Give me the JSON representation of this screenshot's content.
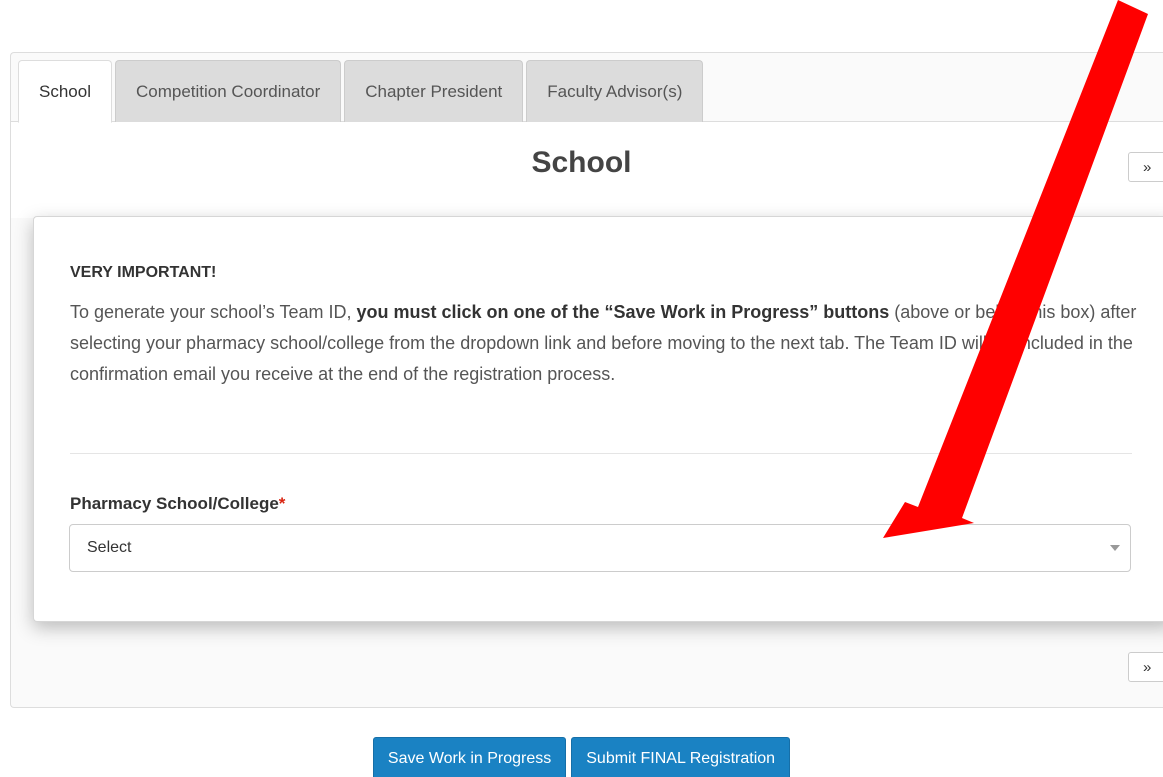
{
  "tabs": [
    {
      "label": "School",
      "active": true
    },
    {
      "label": "Competition Coordinator",
      "active": false
    },
    {
      "label": "Chapter President",
      "active": false
    },
    {
      "label": "Faculty Advisor(s)",
      "active": false
    }
  ],
  "section": {
    "title": "School",
    "next_label": "»"
  },
  "notice": {
    "heading": "VERY IMPORTANT!",
    "text_before": "To generate your school’s Team ID, ",
    "text_bold": "you must click on one of the “Save Work in Progress” buttons",
    "text_after": " (above or below this box) after selecting your pharmacy school/college from the dropdown link and before moving to the next tab. The Team ID will be included in the confirmation email you receive at the end of the registration process."
  },
  "field": {
    "label": "Pharmacy School/College",
    "required_mark": "*",
    "value": "Select"
  },
  "buttons": {
    "save": "Save Work in Progress",
    "submit": "Submit FINAL Registration"
  },
  "colors": {
    "primary_button": "#1a82c3",
    "annotation_arrow": "#ff0000",
    "required": "#d9230f"
  },
  "icons": {
    "dropdown": "caret-down-icon",
    "annotation": "red-arrow-annotation"
  }
}
